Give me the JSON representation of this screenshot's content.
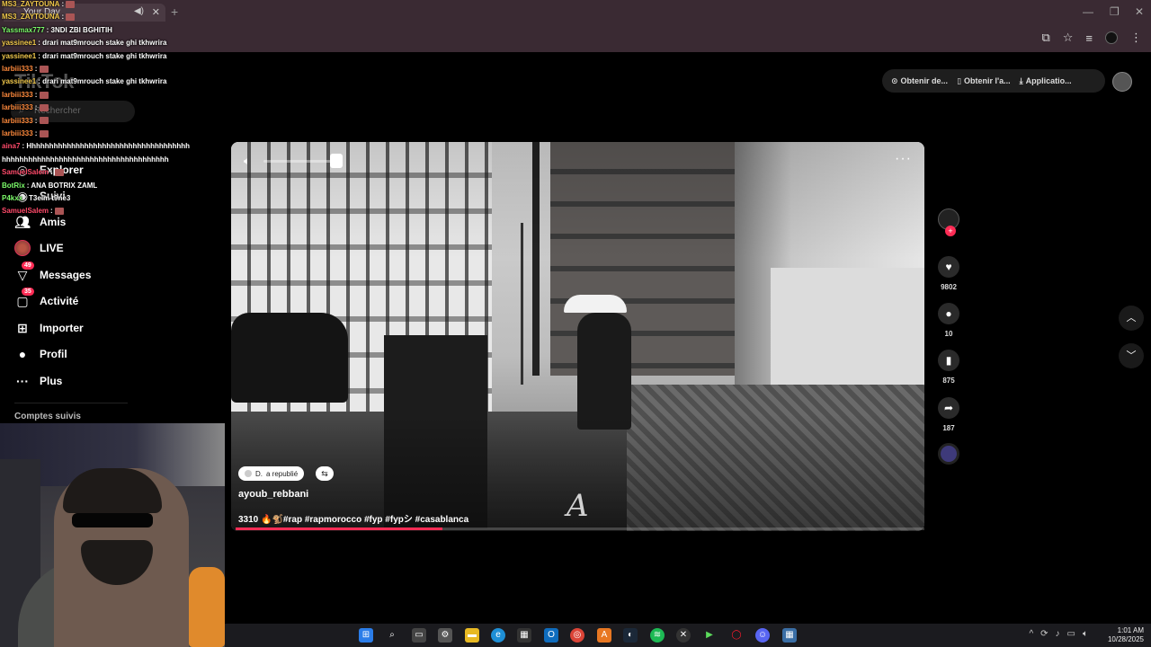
{
  "browser": {
    "tab_title": "Your Day",
    "tab_audio_icon": "speaker-icon",
    "new_tab": "+"
  },
  "tiktok": {
    "logo": "TikTok",
    "search_placeholder": "Rechercher",
    "nav": [
      {
        "label": "Explorer",
        "icon": "compass-icon"
      },
      {
        "label": "Suivi",
        "icon": "following-icon"
      },
      {
        "label": "Amis",
        "icon": "friends-icon"
      },
      {
        "label": "LIVE",
        "icon": "live-icon"
      },
      {
        "label": "Messages",
        "icon": "messages-icon",
        "badge": "49"
      },
      {
        "label": "Activité",
        "icon": "activity-icon",
        "badge": "35"
      },
      {
        "label": "Importer",
        "icon": "upload-icon"
      },
      {
        "label": "Profil",
        "icon": "profile-icon"
      },
      {
        "label": "Plus",
        "icon": "more-icon"
      }
    ],
    "following_title": "Comptes suivis",
    "top_pills": [
      "Obtenir de...",
      "Obtenir l'a...",
      "Applicatio..."
    ],
    "video": {
      "repost_text": "a republié",
      "repost_user": "D.",
      "author": "ayoub_rebbani",
      "caption": "3310 🔥🐒#rap #rapmorocco #fyp #fypシ #casablanca",
      "watermark": "A",
      "progress_percent": 30
    },
    "actions": {
      "likes": "9802",
      "comments": "10",
      "saves": "875",
      "shares": "187"
    }
  },
  "chat": [
    {
      "user": "MS3_ZAYTOUNA",
      "text": "",
      "color": "#f2c94c",
      "emote": true
    },
    {
      "user": "MS3_ZAYTOUNA",
      "text": "",
      "color": "#f2c94c",
      "emote": true
    },
    {
      "user": "Yassmax777",
      "text": "3NDI ZBI BGHITIH",
      "color": "#7cfc6a",
      "emote": false
    },
    {
      "user": "yassinee1",
      "text": "drari mat9mrouch stake ghi tkhwrira",
      "color": "#f2c94c",
      "emote": false
    },
    {
      "user": "yassinee1",
      "text": "drari mat9mrouch stake ghi tkhwrira",
      "color": "#f2c94c",
      "emote": false
    },
    {
      "user": "larbiii333",
      "text": "",
      "color": "#ff8a3c",
      "emote": true
    },
    {
      "user": "yassinee1",
      "text": "drari mat9mrouch stake ghi tkhwrira",
      "color": "#f2c94c",
      "emote": false
    },
    {
      "user": "larbiii333",
      "text": "",
      "color": "#ff8a3c",
      "emote": true
    },
    {
      "user": "larbiii333",
      "text": "",
      "color": "#ff8a3c",
      "emote": true
    },
    {
      "user": "larbiii333",
      "text": "",
      "color": "#ff8a3c",
      "emote": true
    },
    {
      "user": "larbiii333",
      "text": "",
      "color": "#ff8a3c",
      "emote": true
    },
    {
      "user": "aina7",
      "text": "Hhhhhhhhhhhhhhhhhhhhhhhhhhhhhhhhhhhhh",
      "color": "#ff4a6a",
      "emote": false
    },
    {
      "user": "",
      "text": "hhhhhhhhhhhhhhhhhhhhhhhhhhhhhhhhhhhhhh",
      "color": "#ffffff",
      "emote": false
    },
    {
      "user": "SamuelSalem",
      "text": "",
      "color": "#ff4a6a",
      "emote": true
    },
    {
      "user": "BotRix",
      "text": "ANA BOTRIX ZAML",
      "color": "#7cfc6a",
      "emote": false
    },
    {
      "user": "P4kxx",
      "text": "T3elm t9ne3",
      "color": "#7cfc6a",
      "emote": false
    },
    {
      "user": "SamuelSalem",
      "text": "",
      "color": "#ff4a6a",
      "emote": true
    }
  ],
  "taskbar": {
    "icons": [
      "windows-icon",
      "search-icon",
      "taskview-icon",
      "settings-icon",
      "explorer-icon",
      "edge-icon",
      "store-icon",
      "outlook-icon",
      "chrome-icon",
      "app-icon",
      "steam-icon",
      "spotify-icon",
      "xbox-icon",
      "game-icon",
      "opera-icon",
      "discord-icon",
      "calculator-icon"
    ],
    "time": "1:01 AM",
    "date": "10/28/2025"
  },
  "colors": {
    "accent": "#fe2c55",
    "chrome_bg": "#3a2a33",
    "taskbar_bg": "#1b1b1f"
  }
}
